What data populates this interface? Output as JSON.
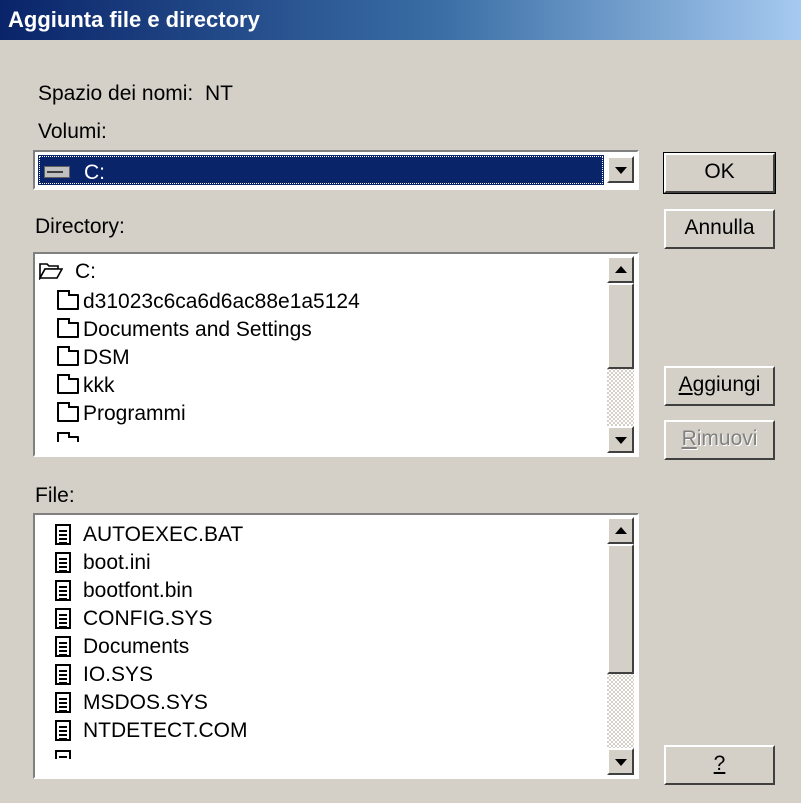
{
  "window": {
    "title": "Aggiunta file e directory"
  },
  "namespace": {
    "label": "Spazio dei nomi:",
    "value": "NT"
  },
  "volumes": {
    "label": "Volumi:",
    "selected": "C:"
  },
  "directory": {
    "label": "Directory:",
    "root": "C:",
    "items": [
      "d31023c6ca6d6ac88e1a5124",
      "Documents and Settings",
      "DSM",
      "kkk",
      "Programmi"
    ]
  },
  "files": {
    "label": "File:",
    "items": [
      "AUTOEXEC.BAT",
      "boot.ini",
      "bootfont.bin",
      "CONFIG.SYS",
      "Documents",
      "IO.SYS",
      "MSDOS.SYS",
      "NTDETECT.COM"
    ]
  },
  "buttons": {
    "ok": "OK",
    "cancel": "Annulla",
    "add_first": "A",
    "add_rest": "ggiungi",
    "remove_first": "R",
    "remove_rest": "imuovi",
    "help": "?"
  },
  "colors": {
    "title_bar": "#0a246a",
    "face": "#d4d0c8",
    "selection": "#0a246a"
  }
}
